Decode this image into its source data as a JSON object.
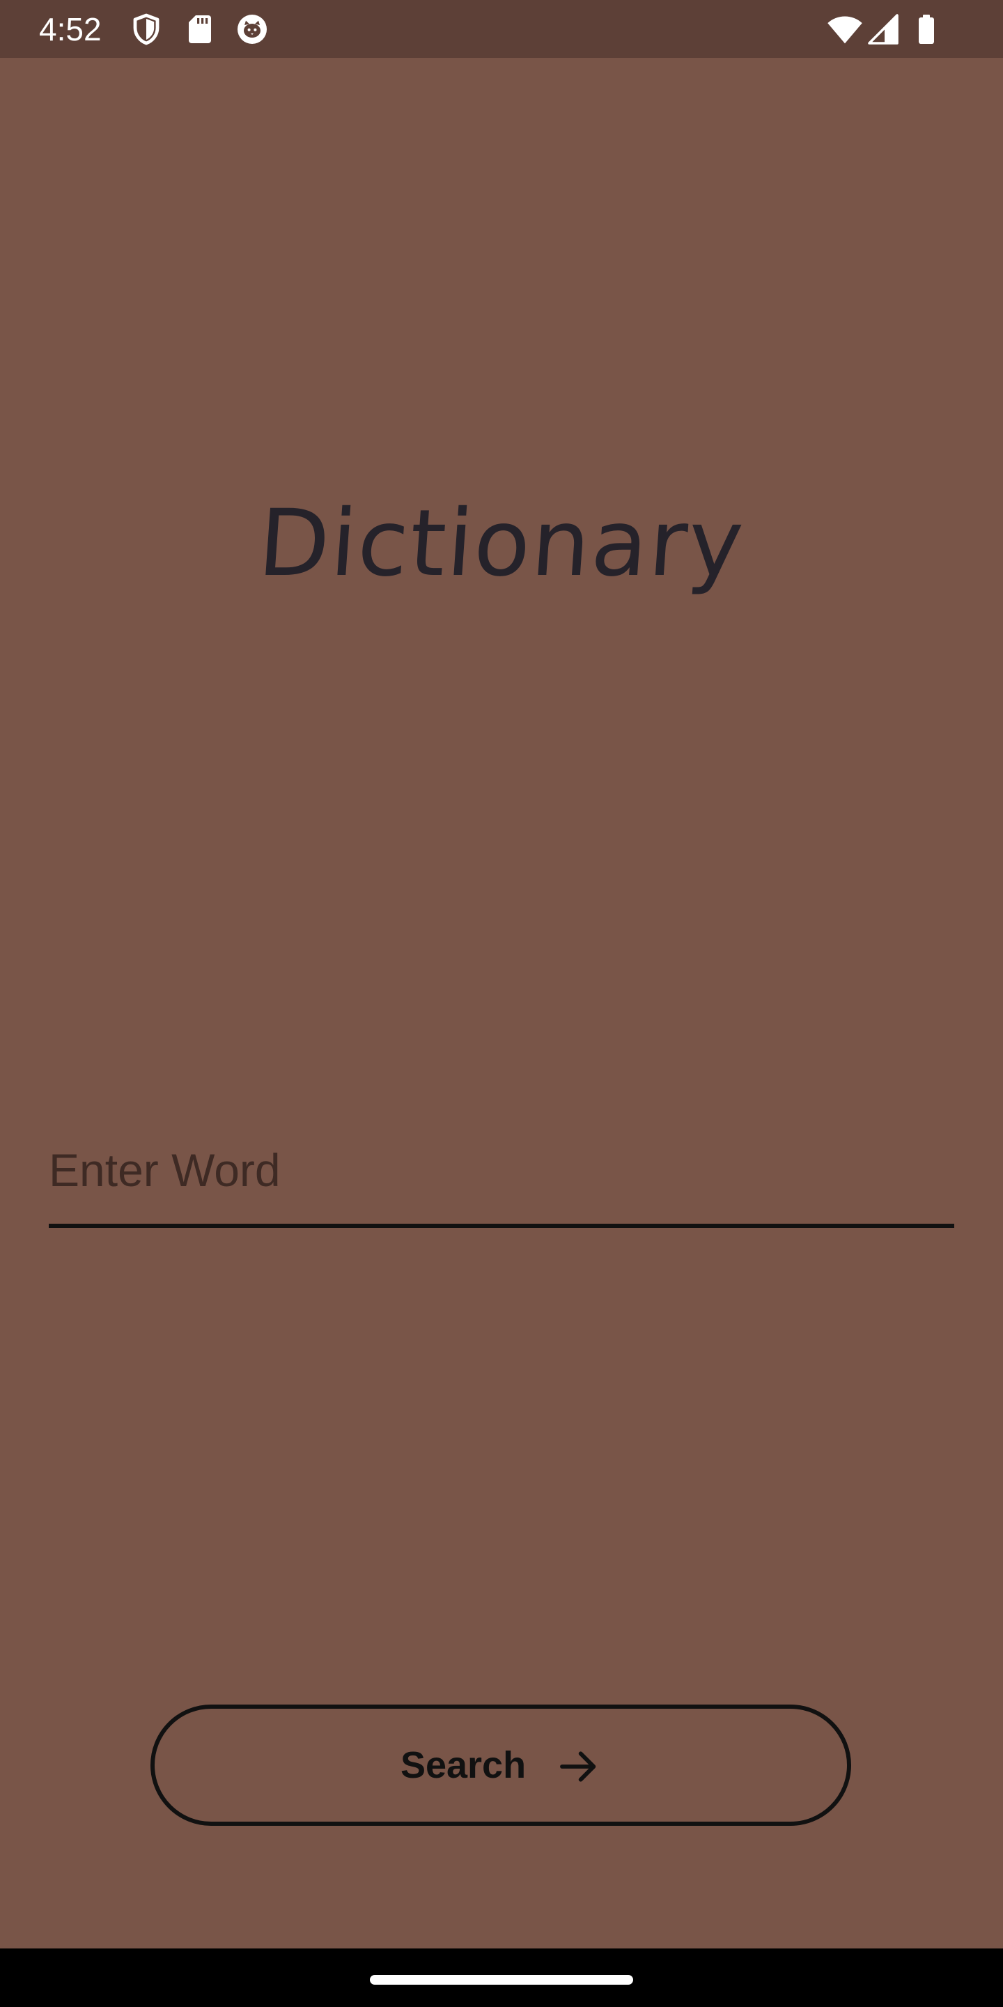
{
  "status_bar": {
    "time": "4:52",
    "left_icons": [
      "shield-icon",
      "sd-card-icon",
      "cat-face-icon"
    ],
    "right_icons": [
      "wifi-icon",
      "signal-icon",
      "battery-icon"
    ]
  },
  "app": {
    "title": "Dictionary"
  },
  "word_input": {
    "placeholder": "Enter Word",
    "value": ""
  },
  "search_button": {
    "label": "Search",
    "icon": "arrow-right-icon"
  },
  "colors": {
    "background": "#795548",
    "status_bar": "#5d4037",
    "text_dark": "#25222a",
    "outline": "#111111"
  }
}
